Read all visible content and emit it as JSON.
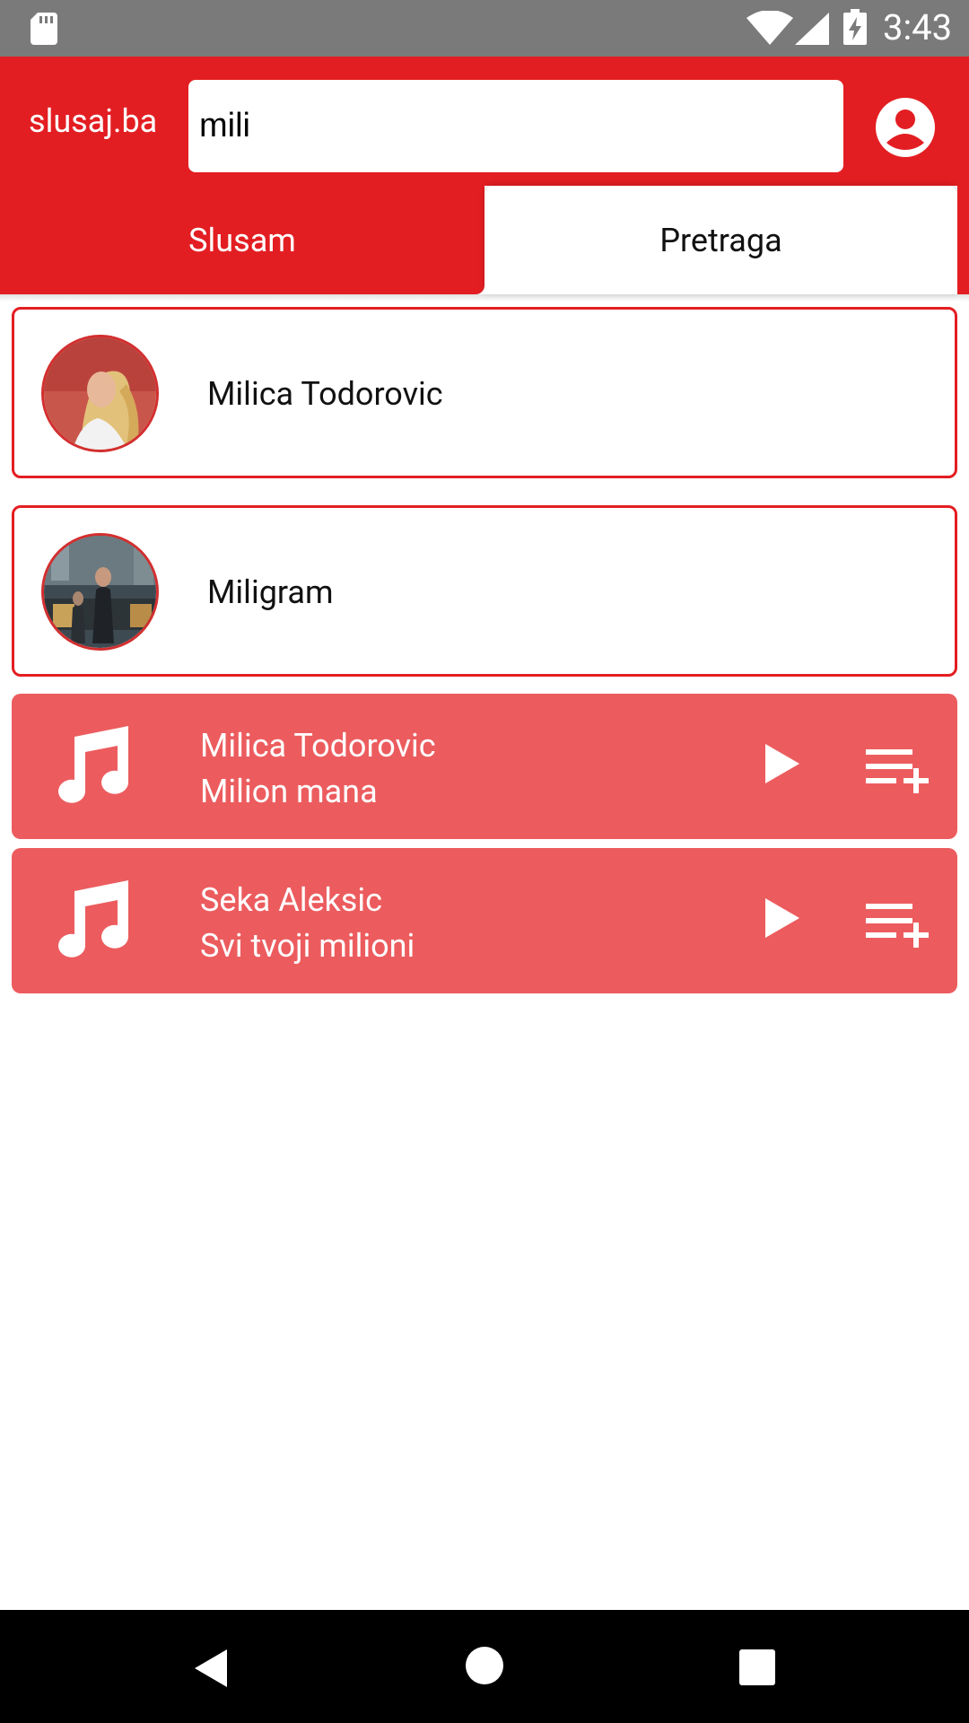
{
  "status_bar": {
    "time": "3:43",
    "icons": [
      "sd-card-icon",
      "wifi-icon",
      "signal-icon",
      "battery-charging-icon"
    ]
  },
  "app_bar": {
    "brand": "slusaj.ba",
    "search_value": "mili",
    "account_icon": "account-circle-icon",
    "color": "#e31e22"
  },
  "tabs": [
    {
      "label": "Slusam",
      "active": false
    },
    {
      "label": "Pretraga",
      "active": true
    }
  ],
  "artists": [
    {
      "name": "Milica Todorovic",
      "avatar": "artist-photo"
    },
    {
      "name": "Miligram",
      "avatar": "band-photo"
    }
  ],
  "songs": [
    {
      "artist": "Milica Todorovic",
      "title": "Milion mana",
      "icon": "music-note-icon",
      "actions": [
        "play-icon",
        "playlist-add-icon"
      ]
    },
    {
      "artist": "Seka Aleksic",
      "title": "Svi tvoji milioni",
      "icon": "music-note-icon",
      "actions": [
        "play-icon",
        "playlist-add-icon"
      ]
    }
  ],
  "colors": {
    "primary": "#e31e22",
    "song_card": "#ec5c5e",
    "status_bar": "#7a7a7a",
    "nav_bar": "#000000"
  },
  "nav_bar": [
    "back-icon",
    "home-icon",
    "recents-icon"
  ]
}
